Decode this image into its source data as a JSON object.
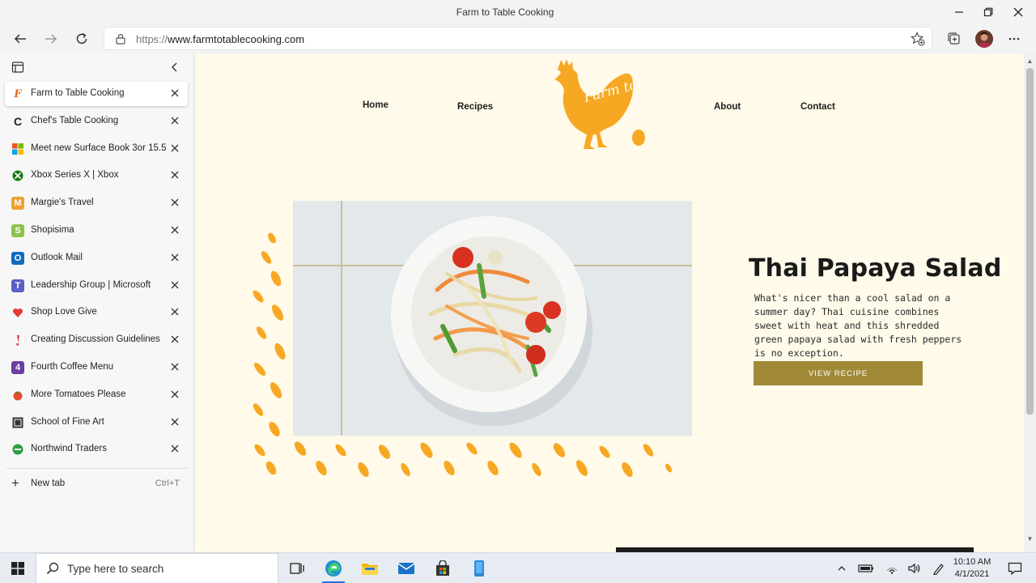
{
  "window": {
    "title": "Farm to Table Cooking"
  },
  "toolbar": {
    "url_protocol": "https://",
    "url_host": "www.farmtotablecooking.com"
  },
  "tabs": [
    {
      "title": "Farm to Table Cooking",
      "active": true,
      "favicon_icon": "farm-to-table-f-icon",
      "favicon_text": "F",
      "color": "#e8641b"
    },
    {
      "title": "Chef's Table Cooking",
      "favicon_icon": "chefs-table-c-icon",
      "favicon_text": "C",
      "color": "#222222"
    },
    {
      "title": "Meet new Surface Book 3or 15.5\"",
      "favicon_icon": "microsoft-logo-icon",
      "color": "#f25022"
    },
    {
      "title": "Xbox Series X | Xbox",
      "favicon_icon": "xbox-icon",
      "color": "#107c10"
    },
    {
      "title": "Margie's Travel",
      "favicon_icon": "margies-travel-m-icon",
      "favicon_text": "M",
      "color": "#f0a030"
    },
    {
      "title": "Shopisima",
      "favicon_icon": "shopisima-s-icon",
      "favicon_text": "S",
      "color": "#8bc34a"
    },
    {
      "title": "Outlook Mail",
      "favicon_icon": "outlook-icon",
      "favicon_text": "O",
      "color": "#0f6cbd"
    },
    {
      "title": "Leadership Group | Microsoft",
      "favicon_icon": "teams-icon",
      "favicon_text": "T",
      "color": "#5b5fc7"
    },
    {
      "title": "Shop Love Give",
      "favicon_icon": "heart-icon",
      "color": "#e53935"
    },
    {
      "title": "Creating Discussion Guidelines",
      "favicon_icon": "exclamation-icon",
      "color": "#e53935"
    },
    {
      "title": "Fourth Coffee Menu",
      "favicon_icon": "fourth-coffee-4-icon",
      "favicon_text": "4",
      "color": "#6b3fa0"
    },
    {
      "title": "More Tomatoes Please",
      "favicon_icon": "tomato-icon",
      "color": "#e84c2f"
    },
    {
      "title": "School of Fine Art",
      "favicon_icon": "school-fine-art-icon",
      "color": "#333333"
    },
    {
      "title": "Northwind Traders",
      "favicon_icon": "northwind-icon",
      "color": "#2e9e3e"
    }
  ],
  "new_tab": {
    "label": "New tab",
    "shortcut": "Ctrl+T"
  },
  "site": {
    "nav": [
      "Home",
      "Recipes",
      "About",
      "Contact"
    ],
    "logo_text": "Farm to Table",
    "recipe": {
      "title": "Thai Papaya Salad",
      "description": "What's nicer than a cool salad on a summer day? Thai cuisine combines sweet with heat and this shredded green papaya salad with fresh peppers is no exception.",
      "button": "VIEW RECIPE"
    },
    "colors": {
      "accent": "#f7a823",
      "button": "#a08a37",
      "background": "#fffae9"
    }
  },
  "taskbar": {
    "search_placeholder": "Type here to search",
    "time": "10:10 AM",
    "date": "4/1/2021"
  }
}
